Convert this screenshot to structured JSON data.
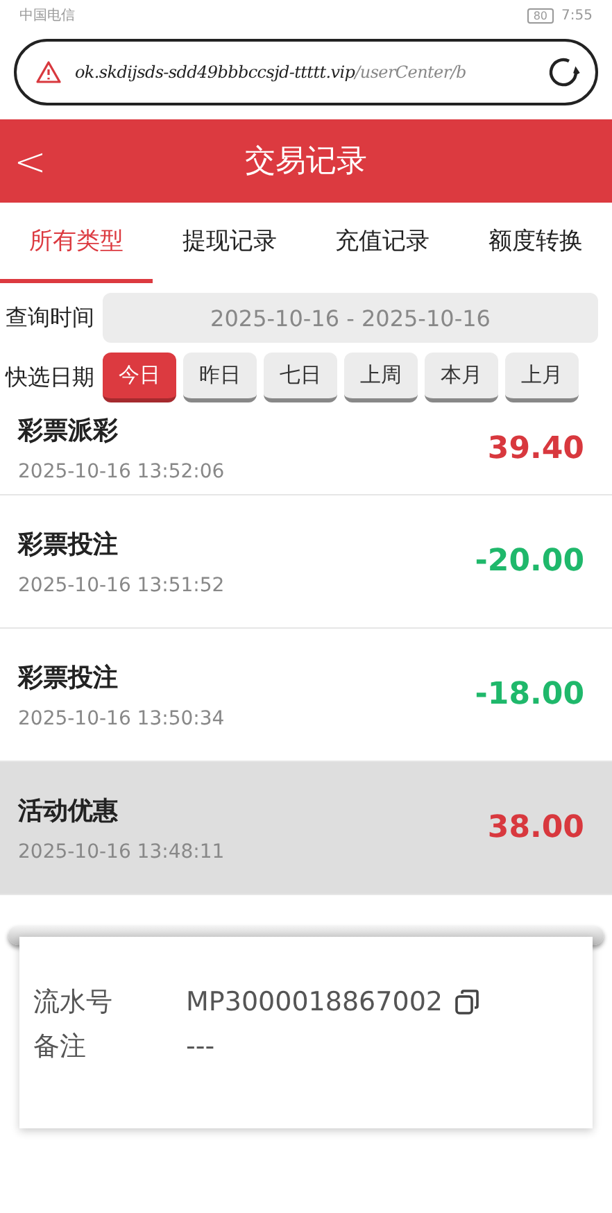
{
  "status_bar": {
    "carrier": "中国电信",
    "battery": "80",
    "time": "7:55"
  },
  "address_bar": {
    "url_host": "ok.skdijsds-sdd49bbbccsjd-ttttt.vip",
    "url_path": "/userCenter/b"
  },
  "header": {
    "back": "<",
    "title": "交易记录"
  },
  "tabs": [
    {
      "label": "所有类型",
      "selected": true
    },
    {
      "label": "提现记录",
      "selected": false
    },
    {
      "label": "充值记录",
      "selected": false
    },
    {
      "label": "额度转换",
      "selected": false
    }
  ],
  "query": {
    "label": "查询时间",
    "value": "2025-10-16 - 2025-10-16"
  },
  "quick_dates": {
    "label": "快选日期",
    "options": [
      {
        "label": "今日",
        "selected": true
      },
      {
        "label": "昨日",
        "selected": false
      },
      {
        "label": "七日",
        "selected": false
      },
      {
        "label": "上周",
        "selected": false
      },
      {
        "label": "本月",
        "selected": false
      },
      {
        "label": "上月",
        "selected": false
      }
    ]
  },
  "records": [
    {
      "title": "彩票派彩",
      "time": "2025-10-16 13:52:06",
      "amount": "39.40",
      "kind": "income",
      "selected": false
    },
    {
      "title": "彩票投注",
      "time": "2025-10-16 13:51:52",
      "amount": "-20.00",
      "kind": "expense",
      "selected": false
    },
    {
      "title": "彩票投注",
      "time": "2025-10-16 13:50:34",
      "amount": "-18.00",
      "kind": "expense",
      "selected": false
    },
    {
      "title": "活动优惠",
      "time": "2025-10-16 13:48:11",
      "amount": "38.00",
      "kind": "income",
      "selected": true
    }
  ],
  "receipt": {
    "rows": [
      {
        "label": "流水号",
        "value": "MP3000018867002",
        "copyable": true
      },
      {
        "label": "备注",
        "value": "---",
        "copyable": false
      }
    ]
  }
}
